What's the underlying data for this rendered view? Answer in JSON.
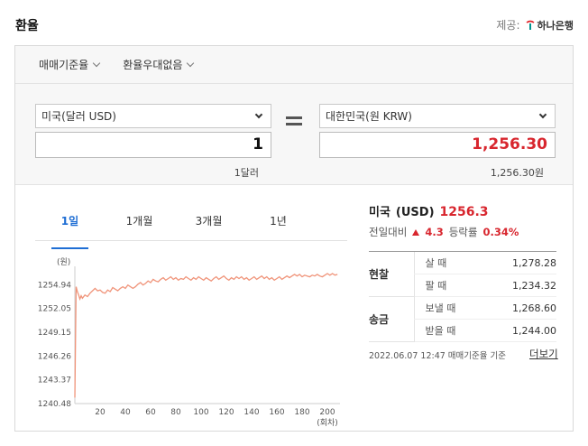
{
  "header": {
    "title": "환율",
    "provider_label": "제공:",
    "provider_name": "하나은행"
  },
  "options": {
    "basis": "매매기준율",
    "preference": "환율우대없음"
  },
  "converter": {
    "from_currency": "미국(달러 USD)",
    "from_amount": "1",
    "from_unit": "1달러",
    "to_currency": "대한민국(원 KRW)",
    "to_amount": "1,256.30",
    "to_unit": "1,256.30원"
  },
  "tabs": [
    "1일",
    "1개월",
    "3개월",
    "1년"
  ],
  "info": {
    "country": "미국",
    "code": "(USD)",
    "rate": "1256.3",
    "prev_label": "전일대비",
    "change": "4.3",
    "pct_label": "등락률",
    "pct": "0.34%"
  },
  "rates": {
    "cash_label": "현찰",
    "buy_label": "살 때",
    "buy_value": "1,278.28",
    "sell_label": "팔 때",
    "sell_value": "1,234.32",
    "transfer_label": "송금",
    "send_label": "보낼 때",
    "send_value": "1,268.60",
    "receive_label": "받을 때",
    "receive_value": "1,244.00"
  },
  "footer": {
    "timestamp": "2022.06.07 12:47 매매기준율 기준",
    "more": "더보기"
  },
  "colors": {
    "accent_blue": "#1f6ed4",
    "up_red": "#d8262e",
    "line": "#f0947a"
  },
  "chart_data": {
    "type": "line",
    "ylabel": "(원)",
    "xlabel": "(회차)",
    "x_ticks": [
      20,
      40,
      60,
      80,
      100,
      120,
      140,
      160,
      180,
      200
    ],
    "y_ticks": [
      1240.48,
      1243.37,
      1246.26,
      1249.15,
      1252.05,
      1254.94
    ],
    "ylim": [
      1240.48,
      1256.3
    ],
    "xlim": [
      0,
      210
    ],
    "grid": false,
    "series": [
      {
        "x": [
          0,
          1,
          2,
          3,
          4,
          5,
          6,
          8,
          10,
          12,
          14,
          16,
          18,
          20,
          22,
          24,
          26,
          28,
          30,
          32,
          34,
          36,
          38,
          40,
          42,
          44,
          46,
          48,
          50,
          52,
          54,
          56,
          58,
          60,
          62,
          64,
          66,
          68,
          70,
          72,
          74,
          76,
          78,
          80,
          82,
          84,
          86,
          88,
          90,
          92,
          94,
          96,
          98,
          100,
          102,
          104,
          106,
          108,
          110,
          112,
          114,
          116,
          118,
          120,
          122,
          124,
          126,
          128,
          130,
          132,
          134,
          136,
          138,
          140,
          142,
          144,
          146,
          148,
          150,
          152,
          154,
          156,
          158,
          160,
          162,
          164,
          166,
          168,
          170,
          172,
          174,
          176,
          178,
          180,
          182,
          184,
          186,
          188,
          190,
          192,
          194,
          196,
          198,
          200,
          202,
          204,
          206,
          208
        ],
        "y": [
          1241.2,
          1254.7,
          1254.1,
          1253.7,
          1253.2,
          1253.6,
          1253.3,
          1253.7,
          1253.5,
          1253.9,
          1254.2,
          1254.5,
          1254.2,
          1254.3,
          1254.0,
          1253.9,
          1254.3,
          1254.1,
          1254.6,
          1254.4,
          1254.2,
          1254.5,
          1254.7,
          1254.5,
          1254.9,
          1254.7,
          1254.5,
          1254.7,
          1255.0,
          1255.2,
          1254.9,
          1255.1,
          1255.4,
          1255.2,
          1255.6,
          1255.4,
          1255.3,
          1255.6,
          1255.8,
          1255.5,
          1255.7,
          1255.9,
          1255.6,
          1255.8,
          1255.5,
          1255.7,
          1255.6,
          1255.9,
          1255.7,
          1255.5,
          1255.8,
          1255.6,
          1255.9,
          1255.7,
          1255.5,
          1255.8,
          1255.6,
          1255.4,
          1255.7,
          1255.9,
          1255.6,
          1255.8,
          1256.0,
          1255.7,
          1255.5,
          1255.8,
          1255.6,
          1255.9,
          1255.7,
          1255.9,
          1255.6,
          1255.8,
          1255.5,
          1255.7,
          1255.9,
          1255.6,
          1255.8,
          1256.0,
          1255.7,
          1255.9,
          1255.6,
          1255.8,
          1255.5,
          1255.7,
          1255.9,
          1255.6,
          1255.8,
          1256.0,
          1255.8,
          1256.0,
          1256.2,
          1256.0,
          1256.2,
          1255.9,
          1256.1,
          1256.0,
          1255.9,
          1256.1,
          1256.0,
          1256.2,
          1256.0,
          1255.9,
          1256.1,
          1256.3,
          1256.1,
          1256.3,
          1256.1,
          1256.2
        ]
      }
    ]
  }
}
